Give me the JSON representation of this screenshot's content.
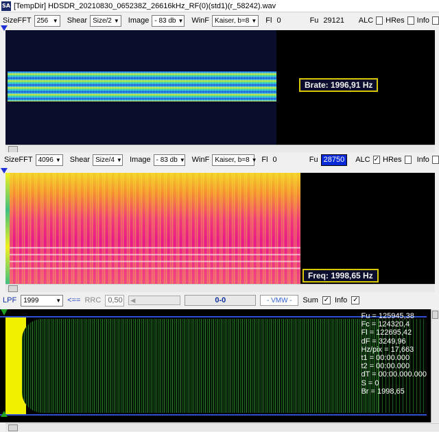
{
  "window": {
    "icon_text": "SA",
    "title": "[TempDir] HDSDR_20210830_065238Z_26616kHz_RF(0)(std1)(r_58242).wav"
  },
  "top_toolbar": {
    "sizefft_label": "SizeFFT",
    "sizefft_value": "256",
    "shear_label": "Shear",
    "shear_value": "Size/2",
    "image_label": "Image",
    "image_value": "- 83 db",
    "winf_label": "WinF",
    "winf_value": "Kaiser, b=8",
    "fl_label": "Fl",
    "fl_value": "0",
    "fu_label": "Fu",
    "fu_value": "29121",
    "alc_label": "ALC",
    "hres_label": "HRes",
    "info_label": "Info"
  },
  "top_panel": {
    "overlay": "Brate: 1996,91 Hz"
  },
  "mid_toolbar": {
    "sizefft_label": "SizeFFT",
    "sizefft_value": "4096",
    "shear_label": "Shear",
    "shear_value": "Size/4",
    "image_label": "Image",
    "image_value": "- 83 db",
    "winf_label": "WinF",
    "winf_value": "Kaiser, b=8",
    "fl_label": "Fl",
    "fl_value": "0",
    "fu_label": "Fu",
    "fu_value": "28750",
    "alc_label": "ALC",
    "hres_label": "HRes",
    "info_label": "Info"
  },
  "mid_panel": {
    "overlay": "Freq: 1998,65 Hz"
  },
  "filter_bar": {
    "lpf_label": "LPF",
    "lpf_value": "1999",
    "arrow": "<==",
    "rrc_label": "RRC",
    "rrc_value": "0,50",
    "range_text": "0-0",
    "vmw_text": "- VMW -",
    "sum_label": "Sum",
    "info_label": "Info"
  },
  "bottom_panel": {
    "readout": [
      "Fu = 125945,38",
      "Fc = 124320,4",
      "Fl = 122695,42",
      "dF = 3249,96",
      "Hz/pix = 17,663",
      "t1 = 00:00.000",
      "t2 = 00:00.000",
      "dT = 00:00.000.000",
      "S = 0",
      "Br = 1998,65"
    ]
  },
  "colors": {
    "marker_blue": "#2030d8",
    "marker_green": "#20a020",
    "overlay_border": "#d8c800",
    "waveform": "#2a7a2a",
    "envelope": "#f0f000"
  }
}
